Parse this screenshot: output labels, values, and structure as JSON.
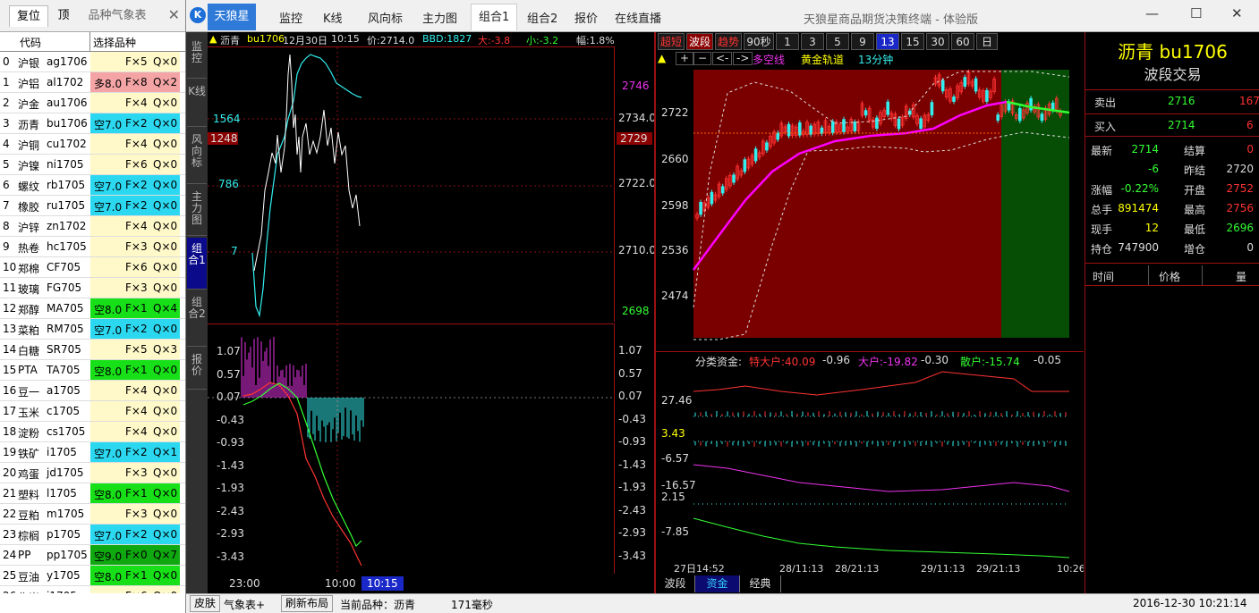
{
  "left_panel": {
    "tabs": [
      "复位",
      "顶",
      "品种气象表"
    ],
    "close": "✕",
    "headers": {
      "code": "代码",
      "select": "选择品种"
    },
    "rows": [
      {
        "i": "0",
        "n": "沪银",
        "c": "ag1706",
        "d": "",
        "f": "F×5",
        "q": "Q×0",
        "bg": ""
      },
      {
        "i": "1",
        "n": "沪铝",
        "c": "al1702",
        "d": "多8.0",
        "f": "F×8",
        "q": "Q×2",
        "bg": "pink"
      },
      {
        "i": "2",
        "n": "沪金",
        "c": "au1706",
        "d": "",
        "f": "F×4",
        "q": "Q×0",
        "bg": ""
      },
      {
        "i": "3",
        "n": "沥青",
        "c": "bu1706",
        "d": "空7.0",
        "f": "F×2",
        "q": "Q×0",
        "bg": "cyan"
      },
      {
        "i": "4",
        "n": "沪铜",
        "c": "cu1702",
        "d": "",
        "f": "F×4",
        "q": "Q×0",
        "bg": ""
      },
      {
        "i": "5",
        "n": "沪镍",
        "c": "ni1705",
        "d": "",
        "f": "F×6",
        "q": "Q×0",
        "bg": ""
      },
      {
        "i": "6",
        "n": "螺纹",
        "c": "rb1705",
        "d": "空7.0",
        "f": "F×2",
        "q": "Q×0",
        "bg": "cyan"
      },
      {
        "i": "7",
        "n": "橡胶",
        "c": "ru1705",
        "d": "空7.0",
        "f": "F×2",
        "q": "Q×0",
        "bg": "cyan"
      },
      {
        "i": "8",
        "n": "沪锌",
        "c": "zn1702",
        "d": "",
        "f": "F×4",
        "q": "Q×0",
        "bg": ""
      },
      {
        "i": "9",
        "n": "热卷",
        "c": "hc1705",
        "d": "",
        "f": "F×3",
        "q": "Q×0",
        "bg": ""
      },
      {
        "i": "10",
        "n": "郑棉",
        "c": "CF705",
        "d": "",
        "f": "F×6",
        "q": "Q×0",
        "bg": ""
      },
      {
        "i": "11",
        "n": "玻璃",
        "c": "FG705",
        "d": "",
        "f": "F×3",
        "q": "Q×0",
        "bg": ""
      },
      {
        "i": "12",
        "n": "郑醇",
        "c": "MA705",
        "d": "空8.0",
        "f": "F×1",
        "q": "Q×4",
        "bg": "green"
      },
      {
        "i": "13",
        "n": "菜粕",
        "c": "RM705",
        "d": "空7.0",
        "f": "F×2",
        "q": "Q×0",
        "bg": "cyan"
      },
      {
        "i": "14",
        "n": "白糖",
        "c": "SR705",
        "d": "",
        "f": "F×5",
        "q": "Q×3",
        "bg": ""
      },
      {
        "i": "15",
        "n": "PTA",
        "c": "TA705",
        "d": "空8.0",
        "f": "F×1",
        "q": "Q×0",
        "bg": "green"
      },
      {
        "i": "16",
        "n": "豆一",
        "c": "a1705",
        "d": "",
        "f": "F×4",
        "q": "Q×0",
        "bg": ""
      },
      {
        "i": "17",
        "n": "玉米",
        "c": "c1705",
        "d": "",
        "f": "F×4",
        "q": "Q×0",
        "bg": ""
      },
      {
        "i": "18",
        "n": "淀粉",
        "c": "cs1705",
        "d": "",
        "f": "F×4",
        "q": "Q×0",
        "bg": ""
      },
      {
        "i": "19",
        "n": "铁矿",
        "c": "i1705",
        "d": "空7.0",
        "f": "F×2",
        "q": "Q×1",
        "bg": "cyan"
      },
      {
        "i": "20",
        "n": "鸡蛋",
        "c": "jd1705",
        "d": "",
        "f": "F×3",
        "q": "Q×0",
        "bg": ""
      },
      {
        "i": "21",
        "n": "塑料",
        "c": "l1705",
        "d": "空8.0",
        "f": "F×1",
        "q": "Q×0",
        "bg": "green"
      },
      {
        "i": "22",
        "n": "豆粕",
        "c": "m1705",
        "d": "",
        "f": "F×3",
        "q": "Q×0",
        "bg": ""
      },
      {
        "i": "23",
        "n": "棕榈",
        "c": "p1705",
        "d": "空7.0",
        "f": "F×2",
        "q": "Q×0",
        "bg": "cyan"
      },
      {
        "i": "24",
        "n": "PP",
        "c": "pp1705",
        "d": "空9.0",
        "f": "F×0",
        "q": "Q×7",
        "bg": "dgreen"
      },
      {
        "i": "25",
        "n": "豆油",
        "c": "y1705",
        "d": "空8.0",
        "f": "F×1",
        "q": "Q×0",
        "bg": "green"
      },
      {
        "i": "26",
        "n": "焦炭",
        "c": "j1705",
        "d": "",
        "f": "F×6",
        "q": "Q×0",
        "bg": ""
      }
    ]
  },
  "titlebar": {
    "logo": "K",
    "app": "天狼星",
    "menus": [
      "监控",
      "K线",
      "风向标",
      "主力图",
      "组合1",
      "组合2",
      "报价",
      "在线直播"
    ],
    "active_menu": "组合1",
    "window_title": "天狼星商品期货决策终端 - 体验版",
    "min": "—",
    "max": "☐",
    "close": "✕"
  },
  "vtabs": [
    "监控",
    "K线",
    "风向标",
    "主力图",
    "组合1",
    "组合2",
    "报价"
  ],
  "tick_panel": {
    "symbol": "沥青",
    "code": "bu1706",
    "date": "12月30日",
    "time": "10:15",
    "price_label": "价:2714.0",
    "bbd": "BBD:1827",
    "big": "大:-3.8",
    "small": "小:-3.2",
    "amp": "幅:1.8%",
    "left_ticks": [
      "1564",
      "1248",
      "786",
      "7"
    ],
    "right_ticks": [
      "2746",
      "2734.0",
      "2729",
      "2722.0",
      "2710.0",
      "2698"
    ],
    "macd_ticks": [
      "1.07",
      "0.57",
      "0.07",
      "-0.43",
      "-0.93",
      "-1.43",
      "-1.93",
      "-2.43",
      "-2.93",
      "-3.43"
    ],
    "time_labels": [
      "23:00",
      "10:00",
      "10:15"
    ]
  },
  "kline": {
    "buttons": [
      "超短",
      "波段",
      "趋势",
      "90秒",
      "1",
      "3",
      "5",
      "9",
      "13",
      "15",
      "30",
      "60",
      "日"
    ],
    "active_button": "13",
    "toolbar": [
      "▲",
      "+",
      "−",
      "<-",
      "->"
    ],
    "legend": [
      "多空线",
      "黄金轨道",
      "13分钟"
    ],
    "y_ticks": [
      "2722",
      "2660",
      "2598",
      "2536",
      "2474"
    ]
  },
  "fund": {
    "label": "分类资金:",
    "items": [
      {
        "label": "特大户:40.09",
        "value": "-0.96"
      },
      {
        "label": "大户:-19.82",
        "value": "-0.30"
      },
      {
        "label": "散户:-15.74",
        "value": "-0.05"
      }
    ],
    "y_ticks": [
      "27.46",
      "3.43",
      "-6.57",
      "-16.57",
      "2.15",
      "-7.85"
    ],
    "x_labels": [
      "27日14:52",
      "28/11:13",
      "28/21:13",
      "29/11:13",
      "29/21:13",
      "10:26"
    ]
  },
  "bottom_tabs": [
    "波段",
    "资金",
    "经典"
  ],
  "active_bottom_tab": "资金",
  "quote": {
    "title": "沥青 bu1706",
    "subtitle": "波段交易",
    "sell": {
      "label": "卖出",
      "price": "2716",
      "vol": "167"
    },
    "buy": {
      "label": "买入",
      "price": "2714",
      "vol": "6"
    },
    "rows": [
      {
        "l1": "最新",
        "v1": "2714",
        "l2": "结算",
        "v2": "0",
        "c1": "green",
        "c2": "red"
      },
      {
        "l1": "",
        "v1": "-6",
        "l2": "昨结",
        "v2": "2720",
        "c1": "green",
        "c2": "white"
      },
      {
        "l1": "涨幅",
        "v1": "-0.22%",
        "l2": "开盘",
        "v2": "2752",
        "c1": "green",
        "c2": "red"
      },
      {
        "l1": "总手",
        "v1": "891474",
        "l2": "最高",
        "v2": "2756",
        "c1": "yellow",
        "c2": "red"
      },
      {
        "l1": "现手",
        "v1": "12",
        "l2": "最低",
        "v2": "2696",
        "c1": "yellow",
        "c2": "green"
      },
      {
        "l1": "持仓",
        "v1": "747900",
        "l2": "增仓",
        "v2": "0",
        "c1": "white",
        "c2": "white"
      }
    ],
    "table_headers": [
      "时间",
      "价格",
      "量"
    ]
  },
  "status": {
    "skin": "皮肤",
    "meteo": "气象表+",
    "refresh": "刷新布局",
    "current": "当前品种：沥青",
    "latency": "171毫秒",
    "datetime": "2016-12-30  10:21:14"
  },
  "colors": {
    "accent": "#2f7ad8",
    "up": "#ff3333",
    "down": "#33ff33",
    "frame": "#9b1010"
  }
}
